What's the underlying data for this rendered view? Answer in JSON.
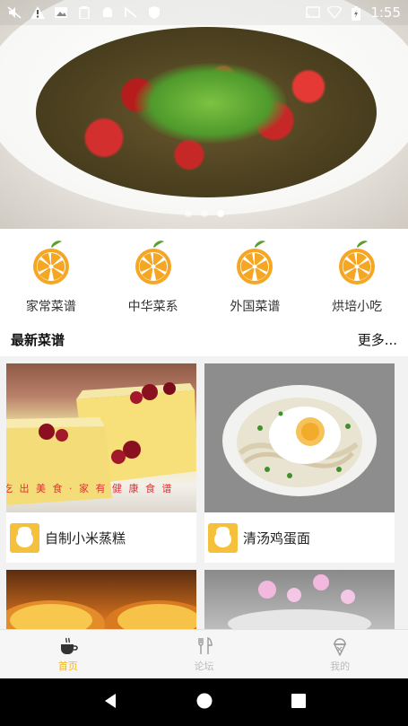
{
  "status_bar": {
    "time": "1:55"
  },
  "banner": {
    "page_count": 3,
    "active_page": 3
  },
  "categories": [
    {
      "label": "家常菜谱",
      "icon": "orange-slice-icon"
    },
    {
      "label": "中华菜系",
      "icon": "orange-slice-icon"
    },
    {
      "label": "外国菜谱",
      "icon": "orange-slice-icon"
    },
    {
      "label": "烘培小吃",
      "icon": "orange-slice-icon"
    }
  ],
  "latest": {
    "title": "最新菜谱",
    "more": "更多..."
  },
  "recipes": [
    {
      "name": "自制小米蒸糕",
      "watermark": "吃  出  美  食 ·  家  有  健  康  食  谱"
    },
    {
      "name": "清汤鸡蛋面"
    },
    {
      "name": ""
    },
    {
      "name": ""
    }
  ],
  "bottom_nav": [
    {
      "label": "首页",
      "icon": "coffee-cup-icon",
      "active": true
    },
    {
      "label": "论坛",
      "icon": "fork-knife-icon",
      "active": false
    },
    {
      "label": "我的",
      "icon": "ice-cream-icon",
      "active": false
    }
  ],
  "colors": {
    "accent": "#f2b619",
    "orange": "#f5a623"
  }
}
